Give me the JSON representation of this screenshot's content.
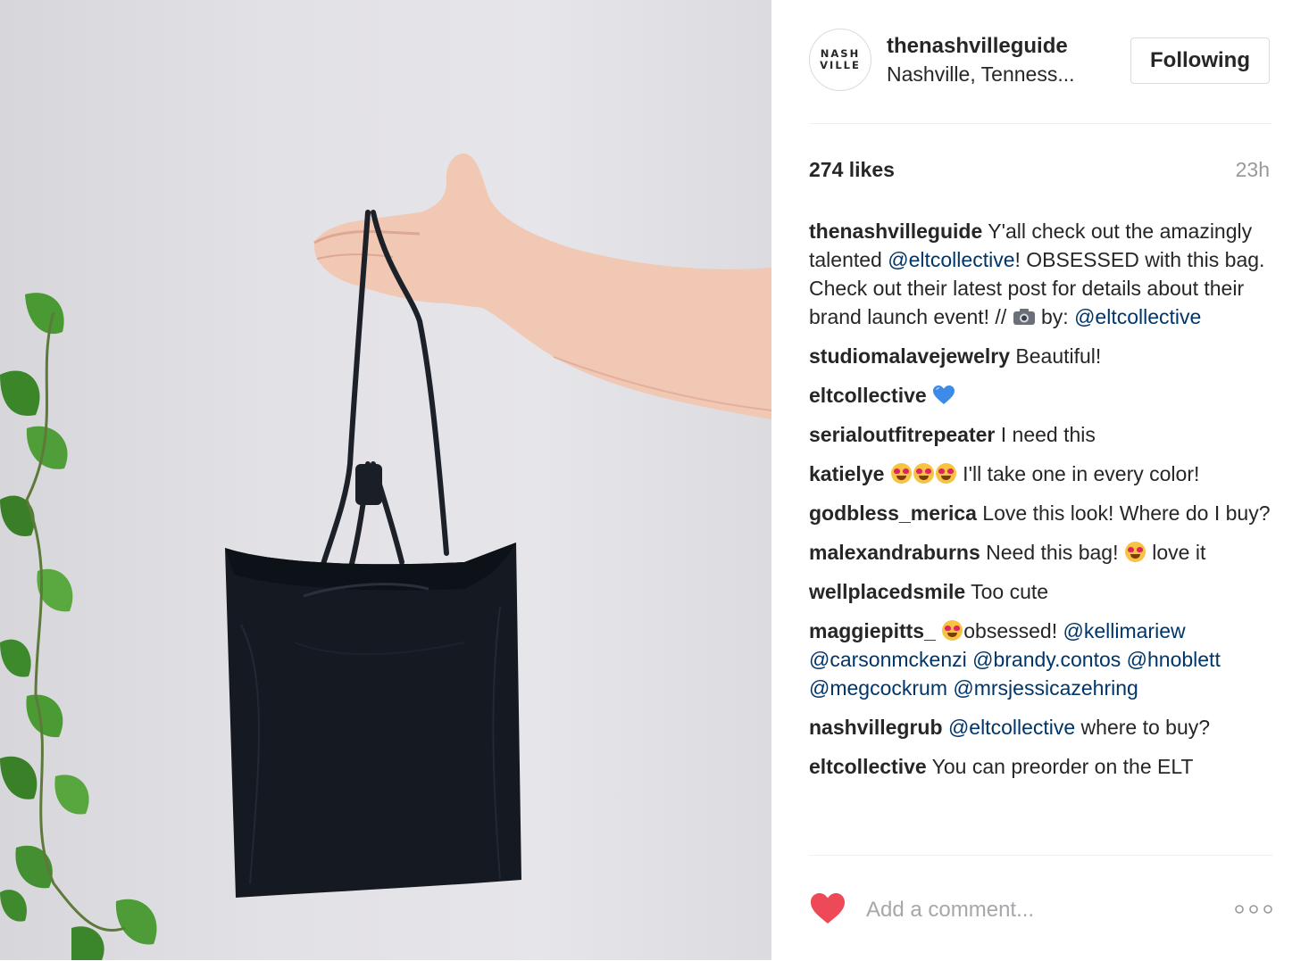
{
  "post": {
    "header": {
      "avatar_lines": [
        "NASH",
        "VILLE"
      ],
      "username": "thenashvilleguide",
      "location": "Nashville, Tenness...",
      "follow_label": "Following"
    },
    "stats": {
      "likes": "274 likes",
      "time": "23h"
    },
    "caption": {
      "user": "thenashvilleguide",
      "text_1": " Y'all check out the amazingly talented ",
      "mention_1": "@eltcollective",
      "text_2": "! OBSESSED with this bag. Check out their latest post for details about their brand launch event! // ",
      "camera_icon": "camera-icon",
      "text_3": " by: ",
      "mention_2": "@eltcollective"
    },
    "comments": [
      {
        "user": "studiomalavejewelry",
        "text": " Beautiful!"
      },
      {
        "user": "eltcollective",
        "text": " ",
        "icon": "blue-heart-icon"
      },
      {
        "user": "serialoutfitrepeater",
        "text": " I need this"
      },
      {
        "user": "katielye",
        "text_after": " I'll take one in every color!",
        "icon": "heart-eyes-emoji x3"
      },
      {
        "user": "godbless_merica",
        "text": " Love this look! Where do I buy?"
      },
      {
        "user": "malexandraburns",
        "text_before": " Need this bag! ",
        "text_after": " love it",
        "icon": "heart-eyes-emoji"
      },
      {
        "user": "wellplacedsmile",
        "text": " Too cute"
      },
      {
        "user": "maggiepitts_",
        "text": "obsessed! ",
        "icon": "heart-eyes-emoji",
        "mentions": [
          "@kellimariew",
          "@carsonmckenzi",
          "@brandy.contos",
          "@hnoblett",
          "@megcockrum",
          "@mrsjessicazehring"
        ]
      },
      {
        "user": "nashvillegrub",
        "mention": "@eltcollective",
        "text": " where to buy?"
      },
      {
        "user": "eltcollective",
        "text": " You can preorder on the ELT"
      }
    ],
    "footer": {
      "like_icon": "heart-icon",
      "comment_placeholder": "Add a comment...",
      "more_icon": "ellipsis-icon"
    },
    "colors": {
      "mention": "#003569",
      "like_heart": "#ed4956",
      "muted": "#999999"
    }
  }
}
